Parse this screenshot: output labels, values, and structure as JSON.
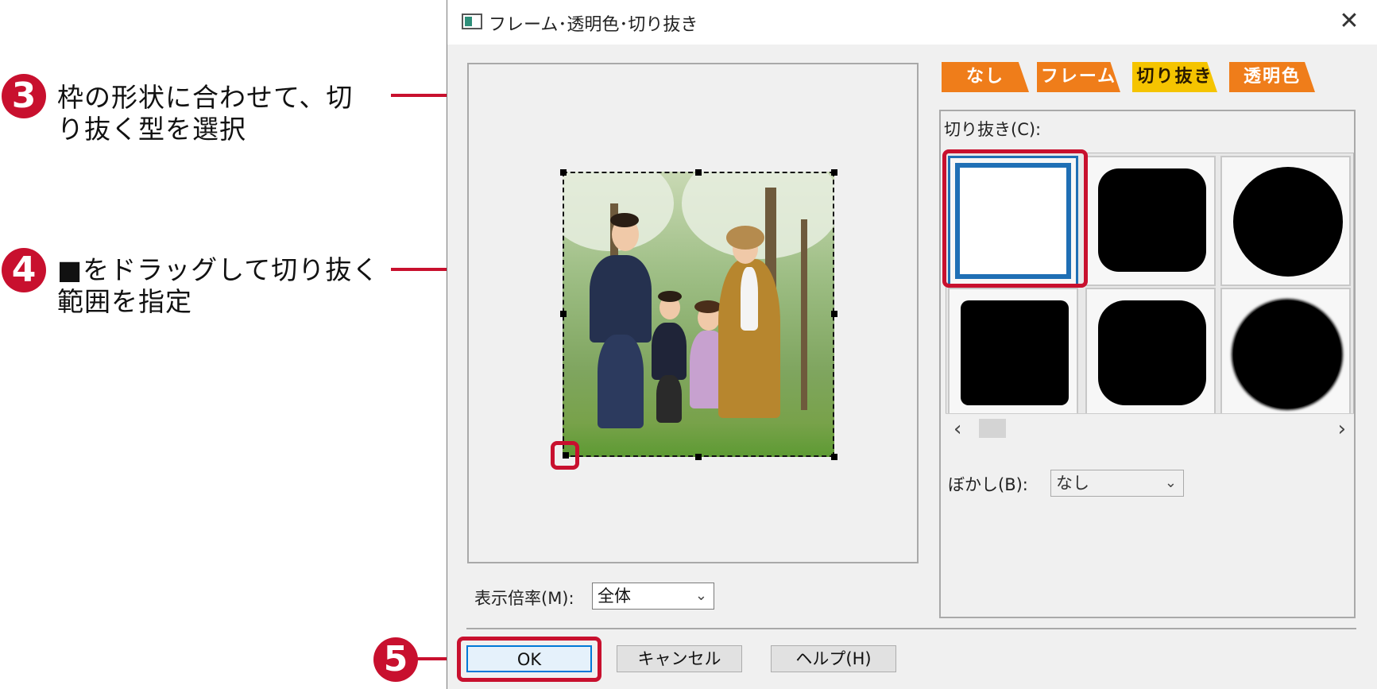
{
  "annotations": {
    "step3": {
      "number": "3",
      "line1": "枠の形状に合わせて、切",
      "line2": "り抜く型を選択"
    },
    "step4": {
      "number": "4",
      "line1": "■をドラッグして切り抜く",
      "line2": "範囲を指定"
    },
    "step5": {
      "number": "5"
    },
    "accent_color": "#c8102e"
  },
  "dialog": {
    "title": "フレーム･透明色･切り抜き",
    "close_glyph": "✕",
    "tabs": [
      {
        "label": "なし",
        "color": "#ef7d1a"
      },
      {
        "label": "フレーム",
        "color": "#ef7d1a"
      },
      {
        "label": "切り抜き",
        "color": "#f5c400",
        "selected": true
      },
      {
        "label": "透明色",
        "color": "#ef7d1a"
      }
    ],
    "crop_label": "切り抜き(C):",
    "crop_shapes": [
      "square-outline-selected",
      "rounded-square",
      "circle",
      "square",
      "rounded-square-large",
      "soft-circle"
    ],
    "scroll_left": "‹",
    "scroll_right": "›",
    "blur_label": "ぼかし(B):",
    "blur_value": "なし",
    "zoom_label": "表示倍率(M):",
    "zoom_value": "全体",
    "buttons": {
      "ok": "OK",
      "cancel": "キャンセル",
      "help": "ヘルプ(H)"
    }
  }
}
